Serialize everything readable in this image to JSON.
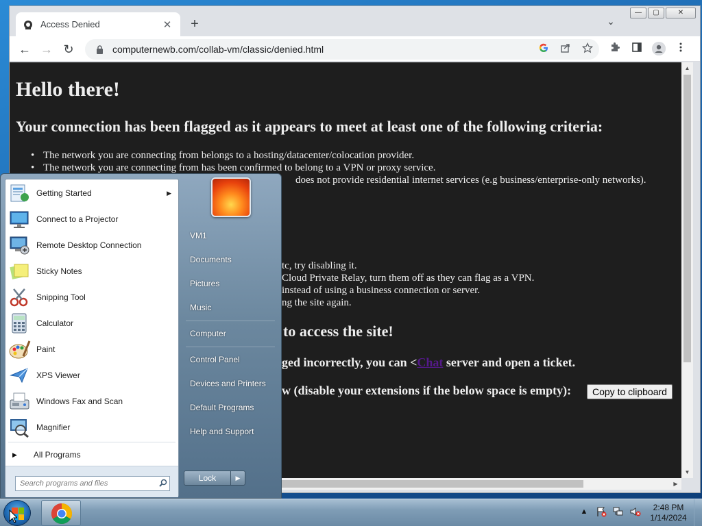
{
  "browser": {
    "tab_title": "Access Denied",
    "tab_close": "✕",
    "new_tab": "+",
    "tab_search": "⌄",
    "win_min": "—",
    "win_max": "▢",
    "win_close": "✕",
    "back": "←",
    "forward": "→",
    "reload": "↻",
    "url": "computernewb.com/collab-vm/classic/denied.html"
  },
  "page": {
    "heading": "Hello there!",
    "subheading": "Your connection has been flagged as it appears to meet at least one of the following criteria:",
    "criteria": [
      "The network you are connecting from belongs to a hosting/datacenter/colocation provider.",
      "The network you are connecting from has been confirmed to belong to a VPN or proxy service.",
      "does not provide residential internet services (e.g business/enterprise-only networks)."
    ],
    "tip_lines": [
      "tc, try disabling it.",
      "Cloud Private Relay, turn them off as they can flag as a VPN.",
      "instead of using a business connection or server.",
      "ng the site again."
    ],
    "access_heading_fragment": "to access the site!",
    "flagged_fragment_pre": "ged incorrectly, you can <",
    "chat_link": "Chat",
    "flagged_fragment_post": " server and open a ticket.",
    "extension_fragment": "w (disable your extensions if the below space is empty):",
    "copy_button": "Copy to clipboard"
  },
  "start_menu": {
    "programs": [
      {
        "label": "Getting Started",
        "icon": "getting-started-icon",
        "has_submenu": true
      },
      {
        "label": "Connect to a Projector",
        "icon": "projector-icon",
        "has_submenu": false
      },
      {
        "label": "Remote Desktop Connection",
        "icon": "remote-desktop-icon",
        "has_submenu": false
      },
      {
        "label": "Sticky Notes",
        "icon": "sticky-notes-icon",
        "has_submenu": false
      },
      {
        "label": "Snipping Tool",
        "icon": "snipping-tool-icon",
        "has_submenu": false
      },
      {
        "label": "Calculator",
        "icon": "calculator-icon",
        "has_submenu": false
      },
      {
        "label": "Paint",
        "icon": "paint-icon",
        "has_submenu": false
      },
      {
        "label": "XPS Viewer",
        "icon": "xps-viewer-icon",
        "has_submenu": false
      },
      {
        "label": "Windows Fax and Scan",
        "icon": "fax-scan-icon",
        "has_submenu": false
      },
      {
        "label": "Magnifier",
        "icon": "magnifier-icon",
        "has_submenu": false
      }
    ],
    "submenu_arrow": "▶",
    "all_programs": "All Programs",
    "search_placeholder": "Search programs and files",
    "right_items": {
      "user": "VM1",
      "documents": "Documents",
      "pictures": "Pictures",
      "music": "Music",
      "computer": "Computer",
      "control_panel": "Control Panel",
      "devices": "Devices and Printers",
      "default_programs": "Default Programs",
      "help": "Help and Support"
    },
    "lock_button": "Lock",
    "lock_arrow": "▶"
  },
  "taskbar": {
    "time": "2:48 PM",
    "date": "1/14/2024",
    "tray_expand": "▲"
  },
  "colors": {
    "page_bg": "#1e1e1e",
    "page_text": "#eeeeee",
    "link": "#551a8b",
    "taskbar": "#7f9db6"
  }
}
